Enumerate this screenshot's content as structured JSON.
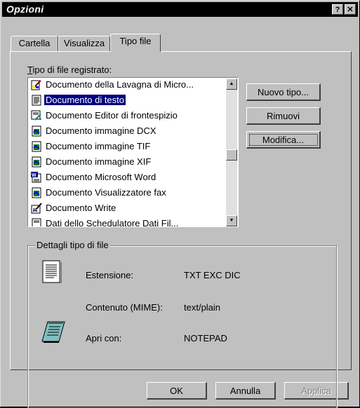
{
  "window": {
    "title": "Opzioni",
    "help_label": "?",
    "close_label": "✕"
  },
  "tabs": [
    {
      "label": "Cartella"
    },
    {
      "label": "Visualizza"
    },
    {
      "label": "Tipo file"
    }
  ],
  "file_types": {
    "label": "Tipo di file registrato:",
    "items": [
      {
        "label": "Documento della Lavagna di Micro...",
        "icon": "paint-document-icon",
        "selected": false
      },
      {
        "label": "Documento di testo",
        "icon": "text-document-icon",
        "selected": true
      },
      {
        "label": "Documento Editor di frontespizio",
        "icon": "cover-page-editor-icon",
        "selected": false
      },
      {
        "label": "Documento immagine DCX",
        "icon": "image-document-icon",
        "selected": false
      },
      {
        "label": "Documento immagine TIF",
        "icon": "image-document-icon",
        "selected": false
      },
      {
        "label": "Documento immagine XIF",
        "icon": "image-document-icon",
        "selected": false
      },
      {
        "label": "Documento Microsoft Word",
        "icon": "word-document-icon",
        "selected": false
      },
      {
        "label": "Documento Visualizzatore fax",
        "icon": "image-document-icon",
        "selected": false
      },
      {
        "label": "Documento Write",
        "icon": "write-document-icon",
        "selected": false
      },
      {
        "label": "Dati dello Schedulatore Dati Fil...",
        "icon": "document-icon",
        "selected": false
      }
    ]
  },
  "buttons": {
    "new_type": "Nuovo tipo...",
    "remove": "Rimuovi",
    "modify": "Modifica...",
    "ok": "OK",
    "cancel": "Annulla",
    "apply": "Applica"
  },
  "details": {
    "title": "Dettagli tipo di file",
    "extension_label": "Estensione:",
    "extension_value": "TXT EXC DIC",
    "content_label": "Contenuto (MIME):",
    "content_value": "text/plain",
    "open_with_label": "Apri con:",
    "open_with_value": "NOTEPAD"
  },
  "colors": {
    "selection": "#000080",
    "face": "#c0c0c0",
    "titlebar": "#000000"
  }
}
